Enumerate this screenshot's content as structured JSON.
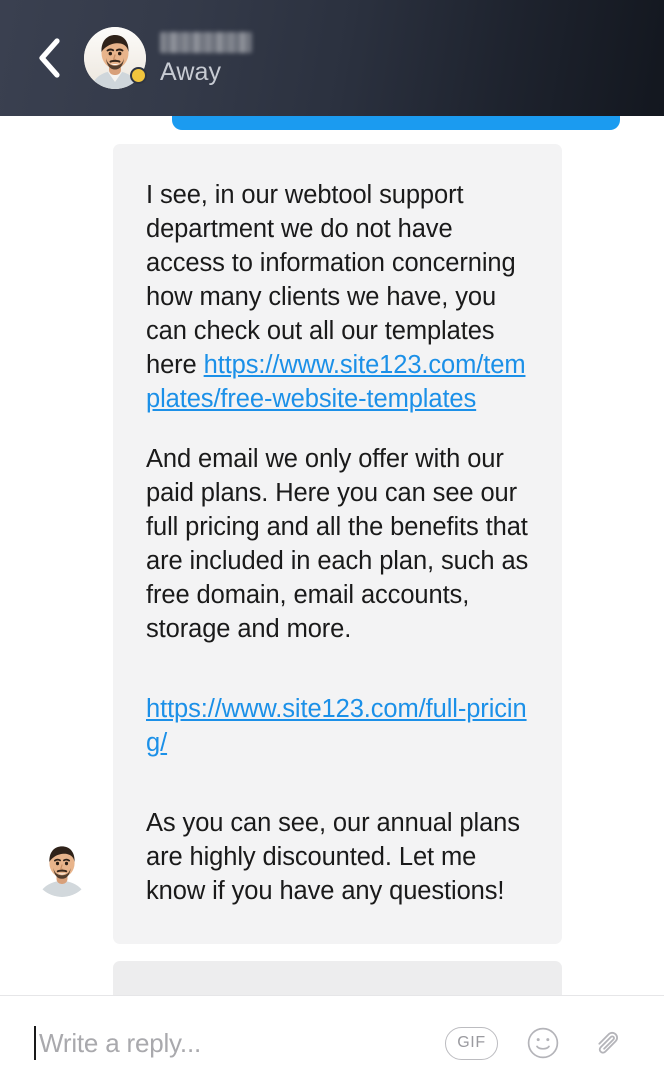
{
  "header": {
    "back_icon": "chevron-left-icon",
    "avatar_icon": "user-avatar-photo",
    "contact_name": "",
    "contact_name_redacted": true,
    "status_label": "Away",
    "status_dot_color": "#f2c53d",
    "background_gradient_from": "#3a4050",
    "background_gradient_to": "#13171f"
  },
  "conversation": {
    "outgoing_bubble_color": "#1b9bf0",
    "incoming_bubble_color": "#f3f3f4",
    "link_color": "#1b90e8",
    "messages": [
      {
        "id": "msg-outgoing-partial",
        "direction": "outgoing",
        "text": "",
        "partially_visible": true
      },
      {
        "id": "msg-incoming-main",
        "direction": "incoming",
        "sender_avatar_icon": "user-avatar-photo",
        "paragraphs": [
          {
            "id": "p1",
            "prefix": "I see, in our webtool support department we do not have access to information concerning how many clients we have, you can check out all our templates here ",
            "link_text": "https://www.site123.com/templates/free-website-templates",
            "suffix": ""
          },
          {
            "id": "p2",
            "prefix": "And email we only offer with our paid plans. Here you can see our full pricing and all the benefits that are included in each plan, such as free domain, email accounts, storage and more.",
            "link_text": "",
            "suffix": ""
          },
          {
            "id": "p3",
            "prefix": "",
            "link_text": "https://www.site123.com/full-pricing/",
            "suffix": ""
          },
          {
            "id": "p4",
            "prefix": "As you can see, our annual plans are highly discounted. Let me know if you have any questions!",
            "link_text": "",
            "suffix": ""
          }
        ]
      },
      {
        "id": "msg-incoming-partial",
        "direction": "incoming",
        "text": "",
        "partially_visible": true
      }
    ]
  },
  "composer": {
    "input_value": "",
    "placeholder": "Write a reply...",
    "gif_label": "GIF",
    "emoji_icon": "smiley-face-icon",
    "attachment_icon": "paperclip-icon"
  }
}
